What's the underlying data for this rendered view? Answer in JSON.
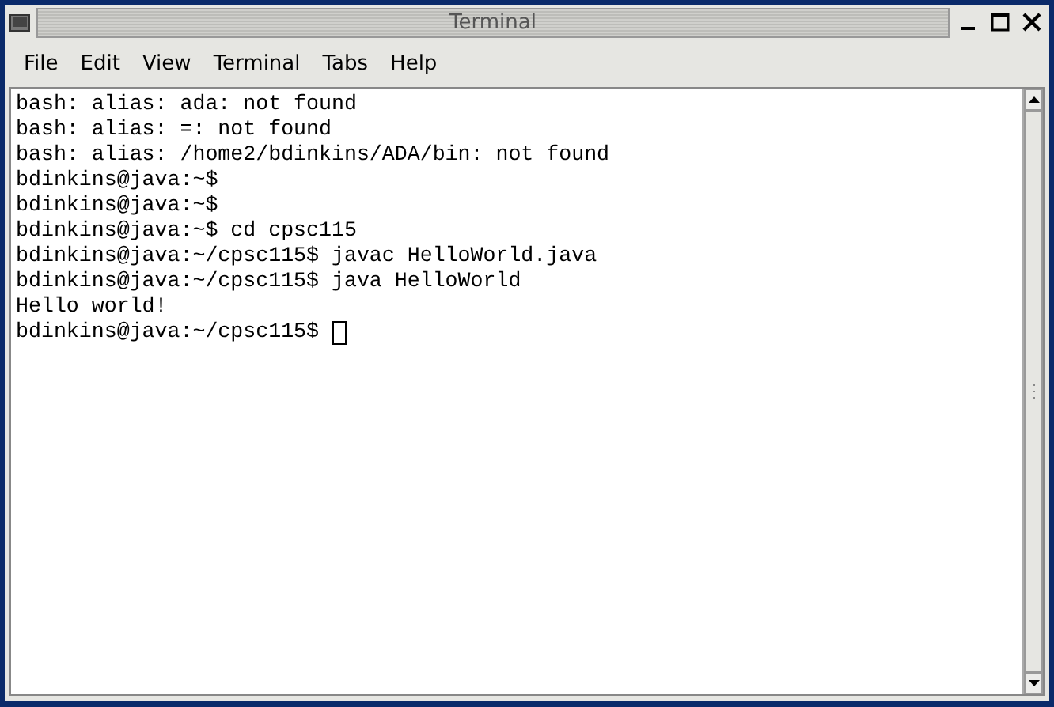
{
  "window": {
    "title": "Terminal"
  },
  "menu": [
    "File",
    "Edit",
    "View",
    "Terminal",
    "Tabs",
    "Help"
  ],
  "terminal": {
    "lines": [
      "bash: alias: ada: not found",
      "bash: alias: =: not found",
      "bash: alias: /home2/bdinkins/ADA/bin: not found",
      "bdinkins@java:~$",
      "bdinkins@java:~$",
      "bdinkins@java:~$ cd cpsc115",
      "bdinkins@java:~/cpsc115$ javac HelloWorld.java",
      "bdinkins@java:~/cpsc115$ java HelloWorld",
      "Hello world!",
      "bdinkins@java:~/cpsc115$ "
    ],
    "cursor": true
  }
}
